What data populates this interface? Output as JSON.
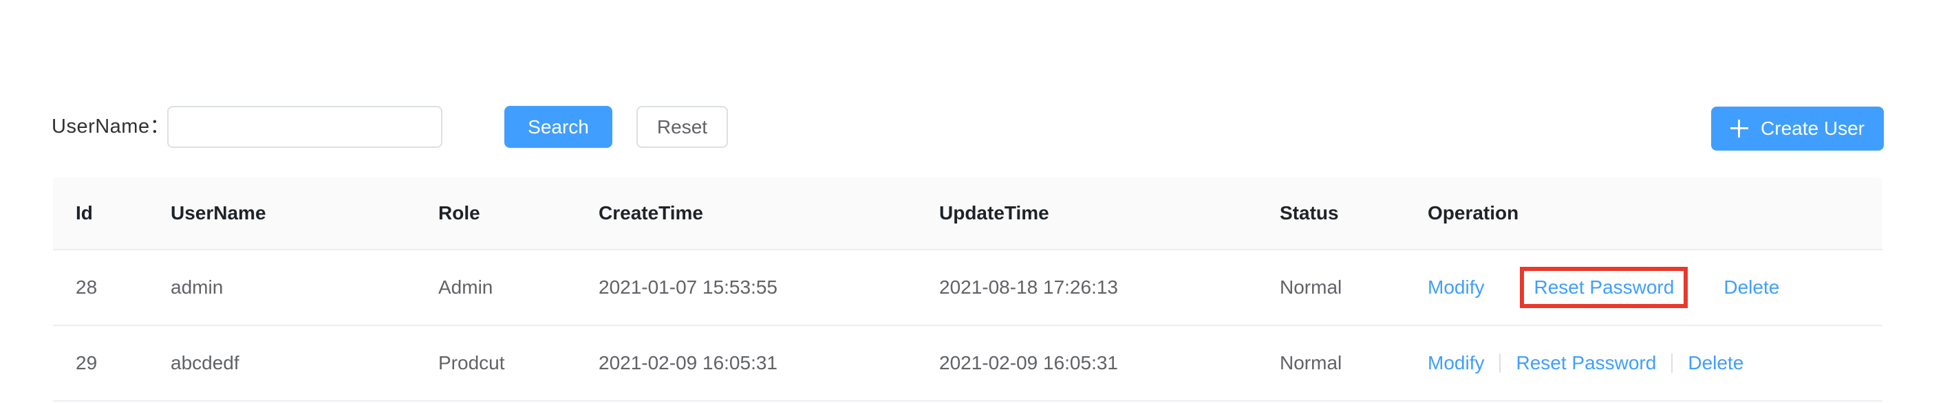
{
  "filter": {
    "label": "UserName：",
    "input_value": "",
    "input_placeholder": "",
    "search_label": "Search",
    "reset_label": "Reset"
  },
  "toolbar": {
    "create_label": "Create User",
    "create_icon": "plus-icon"
  },
  "table": {
    "columns": [
      {
        "key": "id",
        "label": "Id"
      },
      {
        "key": "username",
        "label": "UserName"
      },
      {
        "key": "role",
        "label": "Role"
      },
      {
        "key": "createtime",
        "label": "CreateTime"
      },
      {
        "key": "updatetime",
        "label": "UpdateTime"
      },
      {
        "key": "status",
        "label": "Status"
      },
      {
        "key": "operation",
        "label": "Operation"
      }
    ],
    "rows": [
      {
        "id": "28",
        "username": "admin",
        "role": "Admin",
        "createtime": "2021-01-07 15:53:55",
        "updatetime": "2021-08-18 17:26:13",
        "status": "Normal",
        "operations": {
          "modify": "Modify",
          "reset_password": "Reset Password",
          "delete": "Delete"
        },
        "highlighted_operation": "Reset Password"
      },
      {
        "id": "29",
        "username": "abcdedf",
        "role": "Prodcut",
        "createtime": "2021-02-09 16:05:31",
        "updatetime": "2021-02-09 16:05:31",
        "status": "Normal",
        "operations": {
          "modify": "Modify",
          "reset_password": "Reset Password",
          "delete": "Delete"
        },
        "highlighted_operation": ""
      }
    ]
  },
  "colors": {
    "primary": "#409eff",
    "link": "#409eff",
    "highlight_border": "#e8392c",
    "header_bg": "#fafafa",
    "border": "#ebeef5",
    "text": "#606266"
  }
}
